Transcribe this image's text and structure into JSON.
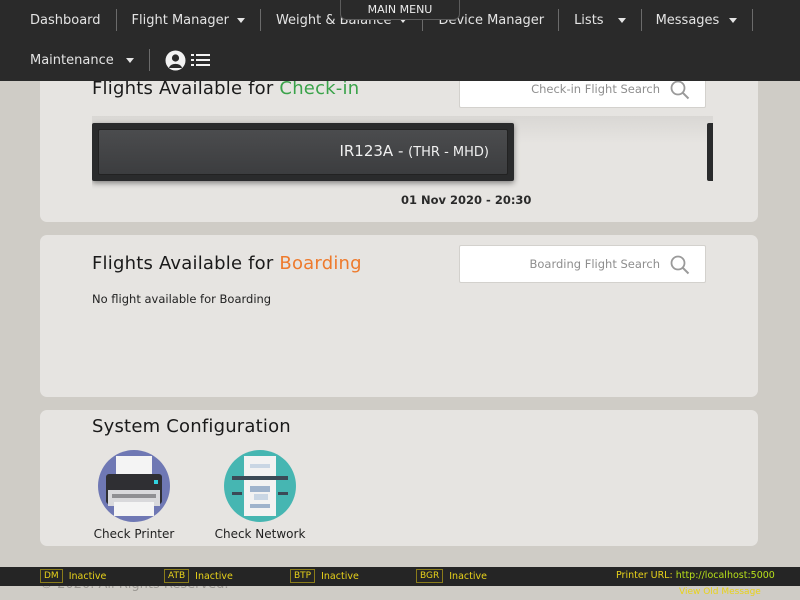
{
  "main_menu": {
    "label": "MAIN MENU"
  },
  "nav": {
    "row1": [
      {
        "label": "Dashboard",
        "dropdown": false
      },
      {
        "label": "Flight Manager",
        "dropdown": true
      },
      {
        "label": "Weight & Balance",
        "dropdown": true
      },
      {
        "label": "Device Manager",
        "dropdown": false
      },
      {
        "label": "Lists",
        "dropdown": true
      },
      {
        "label": "Messages",
        "dropdown": true
      }
    ],
    "row2": [
      {
        "label": "Maintenance",
        "dropdown": true
      }
    ],
    "icons": [
      "user-circle-icon",
      "list-menu-icon"
    ]
  },
  "checkin": {
    "title_prefix": "Flights Available for ",
    "title_accent": "Check-in",
    "accent_color": "#3aa34a",
    "search_placeholder": "Check-in Flight Search",
    "flight": {
      "code": "IR123A - ",
      "route": "(THR - MHD)",
      "date": "01 Nov 2020 - 20:30"
    }
  },
  "boarding": {
    "title_prefix": "Flights Available for ",
    "title_accent": "Boarding",
    "accent_color": "#ee7a2c",
    "search_placeholder": "Boarding Flight Search",
    "empty_message": "No flight available for Boarding"
  },
  "system_config": {
    "title": "System Configuration",
    "items": [
      {
        "label": "Check Printer",
        "icon": "printer-icon"
      },
      {
        "label": "Check Network",
        "icon": "network-icon"
      }
    ]
  },
  "footer": {
    "copyright": "© 2020. All Rights Reserved."
  },
  "status_bar": {
    "items": [
      {
        "badge": "DM",
        "status": "Inactive"
      },
      {
        "badge": "ATB",
        "status": "Inactive"
      },
      {
        "badge": "BTP",
        "status": "Inactive"
      },
      {
        "badge": "BGR",
        "status": "Inactive"
      }
    ],
    "printer_url_label": "Printer URL: ",
    "printer_url": "http://localhost:5000",
    "view_message": "View Old Message"
  }
}
